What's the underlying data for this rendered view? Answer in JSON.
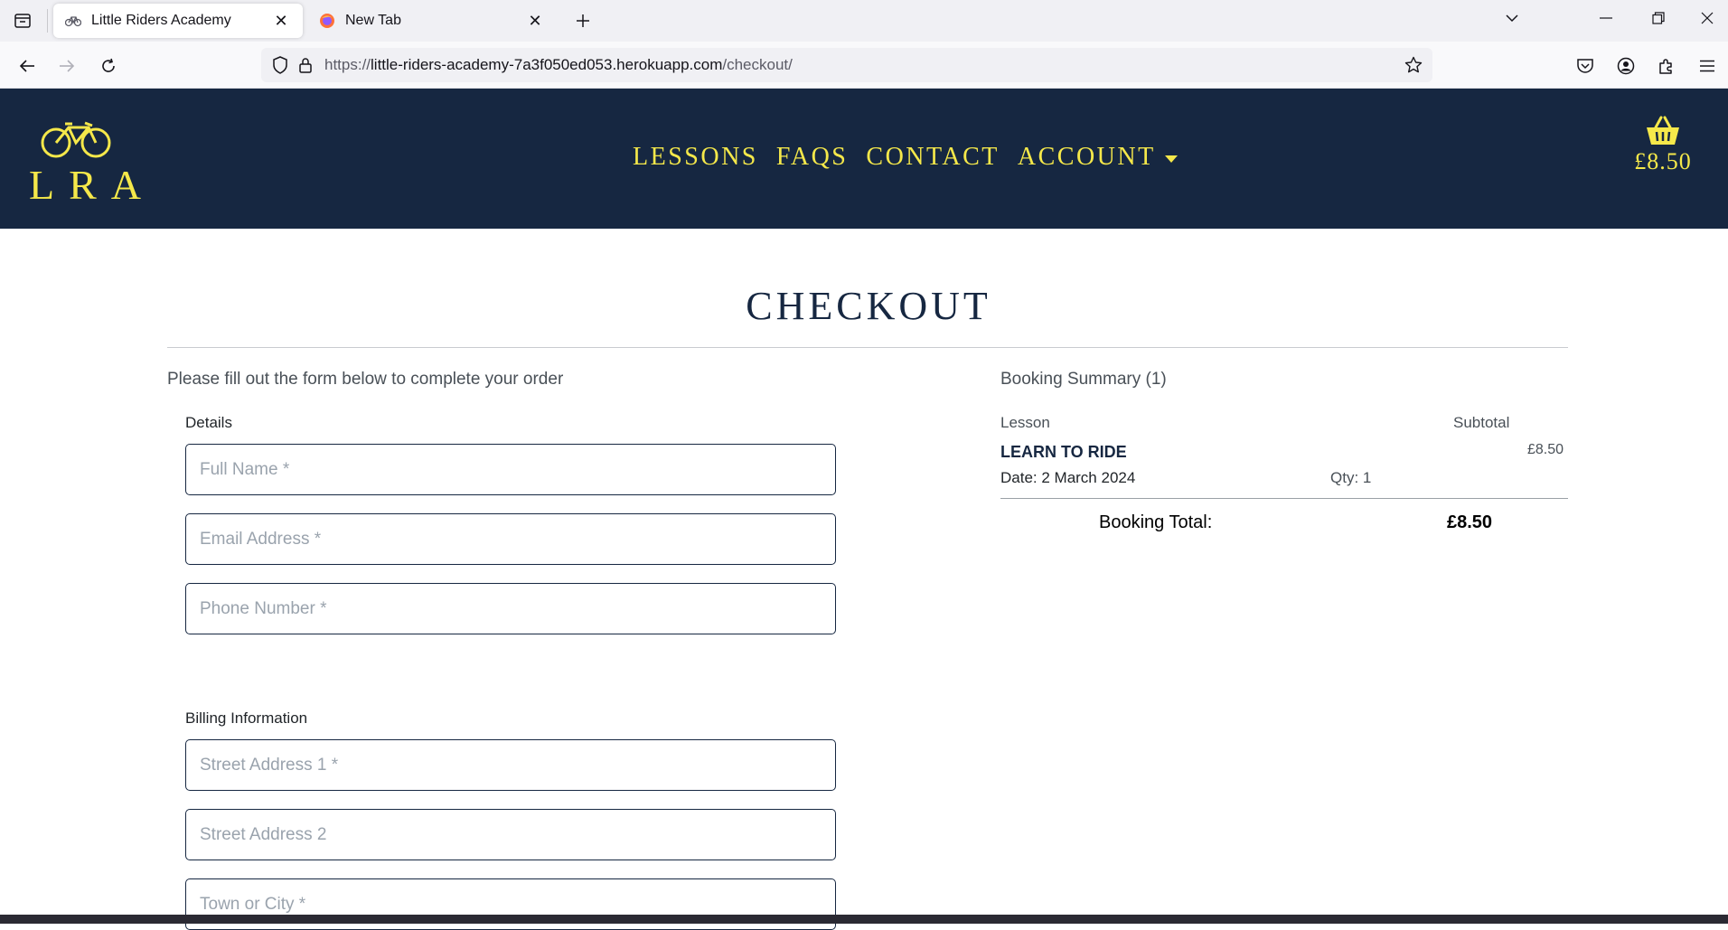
{
  "browser": {
    "tabs": [
      {
        "title": "Little Riders Academy",
        "active": true,
        "icon": "bicycle-icon"
      },
      {
        "title": "New Tab",
        "active": false,
        "icon": "firefox-icon"
      }
    ],
    "url": {
      "scheme": "https://",
      "host": "little-riders-academy-7a3f050ed053.herokuapp.com",
      "path": "/checkout/"
    }
  },
  "site": {
    "logo_text": "LRA",
    "nav": [
      {
        "label": "LESSONS"
      },
      {
        "label": "FAQS"
      },
      {
        "label": "CONTACT"
      },
      {
        "label": "ACCOUNT",
        "dropdown": true
      }
    ],
    "basket_total": "£8.50",
    "brand_color": "#162741",
    "accent_color": "#f5e84a"
  },
  "checkout": {
    "title": "CHECKOUT",
    "intro": "Please fill out the form below to complete your order",
    "details_label": "Details",
    "details_fields": [
      {
        "placeholder": "Full Name *",
        "value": ""
      },
      {
        "placeholder": "Email Address *",
        "value": ""
      },
      {
        "placeholder": "Phone Number *",
        "value": ""
      }
    ],
    "billing_label": "Billing Information",
    "billing_fields": [
      {
        "placeholder": "Street Address 1 *",
        "value": ""
      },
      {
        "placeholder": "Street Address 2",
        "value": ""
      },
      {
        "placeholder": "Town or City *",
        "value": ""
      }
    ]
  },
  "summary": {
    "title": "Booking Summary (1)",
    "col_lesson": "Lesson",
    "col_subtotal": "Subtotal",
    "items": [
      {
        "name": "LEARN TO RIDE",
        "date": "Date: 2 March 2024",
        "qty": "Qty: 1",
        "price": "£8.50"
      }
    ],
    "total_label": "Booking Total:",
    "total_value": "£8.50"
  }
}
